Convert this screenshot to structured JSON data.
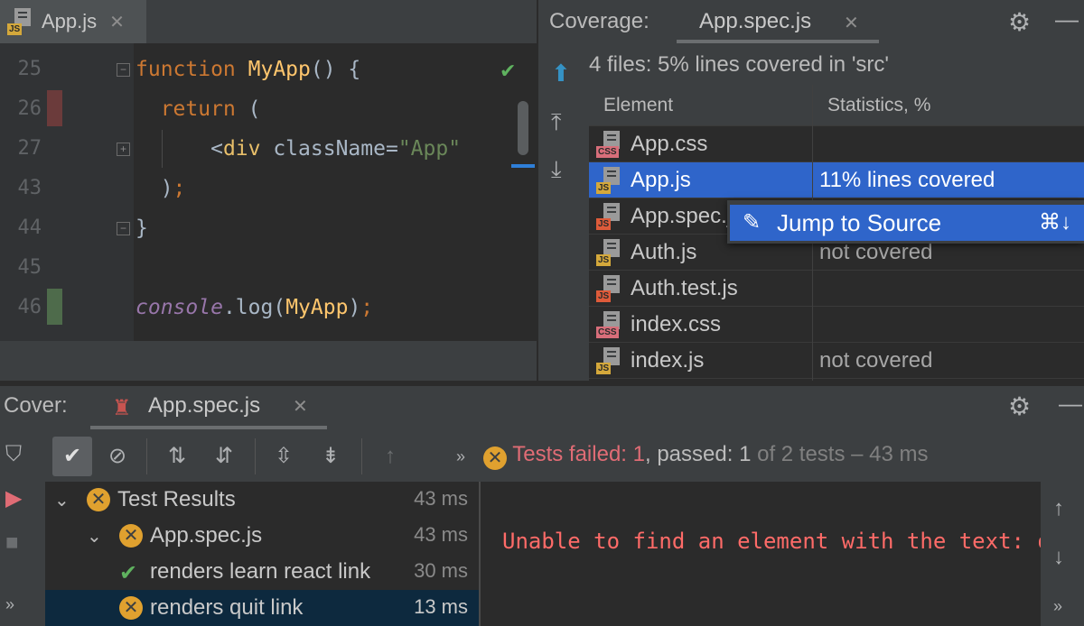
{
  "editor": {
    "tab": {
      "badge": "JS",
      "label": "App.js",
      "close": "✕"
    },
    "lines": [
      {
        "num": "25",
        "parts": [
          [
            "kw",
            "function "
          ],
          [
            "fn",
            "MyApp"
          ],
          [
            "pl",
            "() {"
          ]
        ]
      },
      {
        "num": "26",
        "parts": [
          [
            "pl",
            "  "
          ],
          [
            "kw",
            "return"
          ],
          [
            "pl",
            " ("
          ]
        ]
      },
      {
        "num": "27",
        "parts": [
          [
            "pl",
            "      <"
          ],
          [
            "tag",
            "div"
          ],
          [
            "pl",
            " className="
          ],
          [
            "str",
            "\"App\""
          ]
        ]
      },
      {
        "num": "43",
        "parts": [
          [
            "pl",
            "  )"
          ],
          [
            "kw",
            ";"
          ]
        ]
      },
      {
        "num": "44",
        "parts": [
          [
            "pl",
            "}"
          ]
        ]
      },
      {
        "num": "45",
        "parts": []
      },
      {
        "num": "46",
        "parts": [
          [
            "con",
            "console"
          ],
          [
            "pl",
            "."
          ],
          [
            "pl",
            "log("
          ],
          [
            "fn",
            "MyApp"
          ],
          [
            "pl",
            ")"
          ],
          [
            "kw",
            ";"
          ]
        ]
      }
    ]
  },
  "coverage": {
    "title": "Coverage:",
    "tab_label": "App.spec.js",
    "tab_close": "✕",
    "summary": "4 files: 5% lines covered in 'src'",
    "columns": [
      "Element",
      "Statistics, %"
    ],
    "rows": [
      {
        "name": "App.css",
        "badge": "CSS",
        "kind": "css",
        "stat": ""
      },
      {
        "name": "App.js",
        "badge": "JS",
        "kind": "js",
        "stat": "11% lines covered",
        "selected": true
      },
      {
        "name": "App.spec.js",
        "badge": "JS",
        "kind": "test",
        "stat": ""
      },
      {
        "name": "Auth.js",
        "badge": "JS",
        "kind": "js",
        "stat": "not covered"
      },
      {
        "name": "Auth.test.js",
        "badge": "JS",
        "kind": "test",
        "stat": ""
      },
      {
        "name": "index.css",
        "badge": "CSS",
        "kind": "css",
        "stat": ""
      },
      {
        "name": "index.js",
        "badge": "JS",
        "kind": "js",
        "stat": "not covered"
      }
    ],
    "popup": {
      "label": "Jump to Source",
      "shortcut": "⌘↓"
    }
  },
  "run": {
    "title": "Cover:",
    "tab_label": "App.spec.js",
    "tab_close": "✕",
    "status": {
      "failed_label": "Tests failed: ",
      "failed_count": "1",
      "sep": ", passed: ",
      "passed_count": "1",
      "rest": " of 2 tests – 43 ms"
    },
    "more": "»",
    "tree": [
      {
        "label": "Test Results",
        "time": "43 ms",
        "state": "fail",
        "depth": 0,
        "expanded": true
      },
      {
        "label": "App.spec.js",
        "time": "43 ms",
        "state": "fail",
        "depth": 1,
        "expanded": true
      },
      {
        "label": "renders learn react link",
        "time": "30 ms",
        "state": "pass",
        "depth": 2
      },
      {
        "label": "renders quit link",
        "time": "13 ms",
        "state": "fail",
        "depth": 2,
        "selected": true
      }
    ],
    "console": "Unable to find an element with the text: quit"
  },
  "colors": {
    "accent": "#2f65ca",
    "fail": "#e0a12f",
    "error_text": "#ff6b68",
    "pass": "#5fb25f"
  }
}
